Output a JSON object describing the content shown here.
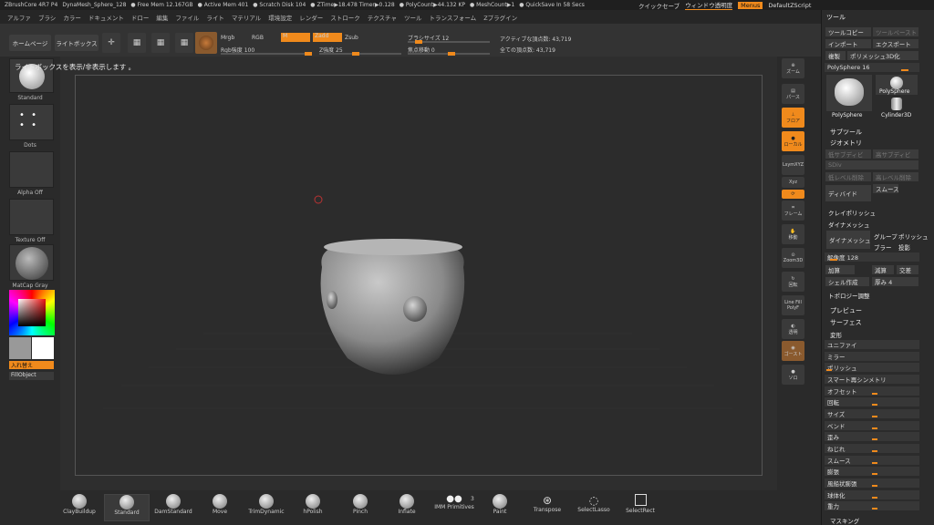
{
  "titlebar": {
    "app": "ZBrushCore 4R7 P4",
    "doc": "DynaMesh_Sphere_128",
    "free_mem": "● Free Mem 12.167GB",
    "active_mem": "● Active Mem 401",
    "scratch": "● Scratch Disk 104",
    "ztime": "● ZTime▶18.478 Timer▶0.128",
    "polycount": "● PolyCount▶44.132 KP",
    "meshcount": "● MeshCount▶1",
    "quicksave": "● QuickSave In 58 Secs"
  },
  "topright": {
    "quicksave_btn": "クイックセーブ",
    "window_transparency": "ウィンドウ透明度",
    "menus": "Menus",
    "script": "DefaultZScript"
  },
  "menu": [
    "アルファ",
    "ブラシ",
    "カラー",
    "ドキュメント",
    "ドロー",
    "編集",
    "ファイル",
    "ライト",
    "マテリアル",
    "環境設定",
    "レンダー",
    "ストローク",
    "テクスチャ",
    "ツール",
    "トランスフォーム",
    "Zプラグイン"
  ],
  "toolbar": {
    "home": "ホームページ",
    "lightbox": "ライトボックス",
    "draw": "ドロー",
    "move": "移動",
    "scale": "スケール",
    "rotate": "回転",
    "mrgb": "Mrgb",
    "rgb": "RGB",
    "m": "M",
    "zadd": "Zadd",
    "zsub": "Zsub",
    "rgb_intensity": "Rgb強度 100",
    "z_intensity": "Z強度 25",
    "brush_size": "ブラシサイズ 12",
    "focal_shift": "焦点移動 0",
    "active_points": "アクティブな頂点数: 43,719",
    "total_points": "全ての頂点数: 43,719"
  },
  "hint": "ライトボックスを表示/非表示します 。",
  "leftshelf": {
    "brush": "Standard",
    "stroke": "Dots",
    "alpha": "Alpha Off",
    "texture": "Texture Off",
    "material": "MatCap Gray",
    "switch": "入れ替え",
    "fill": "FillObject"
  },
  "rightstrip": [
    "ズーム",
    "パース",
    "フロア",
    "ローカル",
    "LsymXYZ",
    "Xyz",
    "フレーム",
    "移動",
    "Zoom3D",
    "回転",
    "Line Fill",
    "PolyF",
    "透明",
    "ゴースト",
    "ソロ"
  ],
  "panel": {
    "title": "ツール",
    "copy": "ツールコピー",
    "paste": "ツールペースト",
    "import": "インポート",
    "export": "エクスポート",
    "clone": "複製",
    "make_polymesh": "ポリメッシュ3D化",
    "polysphere": "PolySphere  16",
    "poly_a": "PolySphere",
    "poly_b": "PolySphere",
    "cylinder": "Cylinder3D",
    "subtool": "サブツール",
    "geometry": "ジオメトリ",
    "lower_subdiv": "低サブディビ",
    "higher_subdiv": "高サブディビ",
    "sdiv": "SDiv",
    "del_lower": "低レベル削除",
    "del_higher": "高レベル削除",
    "divide": "ディバイド",
    "smooth": "スムース",
    "claypolish": "クレイポリッシュ",
    "dynamesh_head": "ダイナメッシュ",
    "dynamesh_btn": "ダイナメッシュ",
    "groups": "グループ",
    "polish": "ポリッシュ",
    "blur": "ブラー",
    "project": "投影",
    "resolution": "解像度 128",
    "add": "加算",
    "sub": "減算",
    "and": "交差",
    "create_shell": "シェル作成",
    "thickness": "厚み 4",
    "topology": "トポロジー調整",
    "preview": "プレビュー",
    "surface": "サーフェス",
    "deformation": "変形",
    "deform_items": [
      "ユニファイ",
      "ミラー",
      "ポリッシュ",
      "スマート再シンメトリ",
      "オフセット",
      "回転",
      "サイズ",
      "ベンド",
      "歪み",
      "ねじれ",
      "スムース",
      "膨張",
      "風船状膨張",
      "球体化",
      "重力"
    ],
    "masking": "マスキング"
  },
  "brushes": [
    "ClayBuildup",
    "Standard",
    "DamStandard",
    "Move",
    "TrimDynamic",
    "hPolish",
    "Pinch",
    "Inflate",
    "IMM Primitives",
    "Paint",
    "Transpose",
    "SelectLasso",
    "SelectRect"
  ],
  "imm_count": "3"
}
